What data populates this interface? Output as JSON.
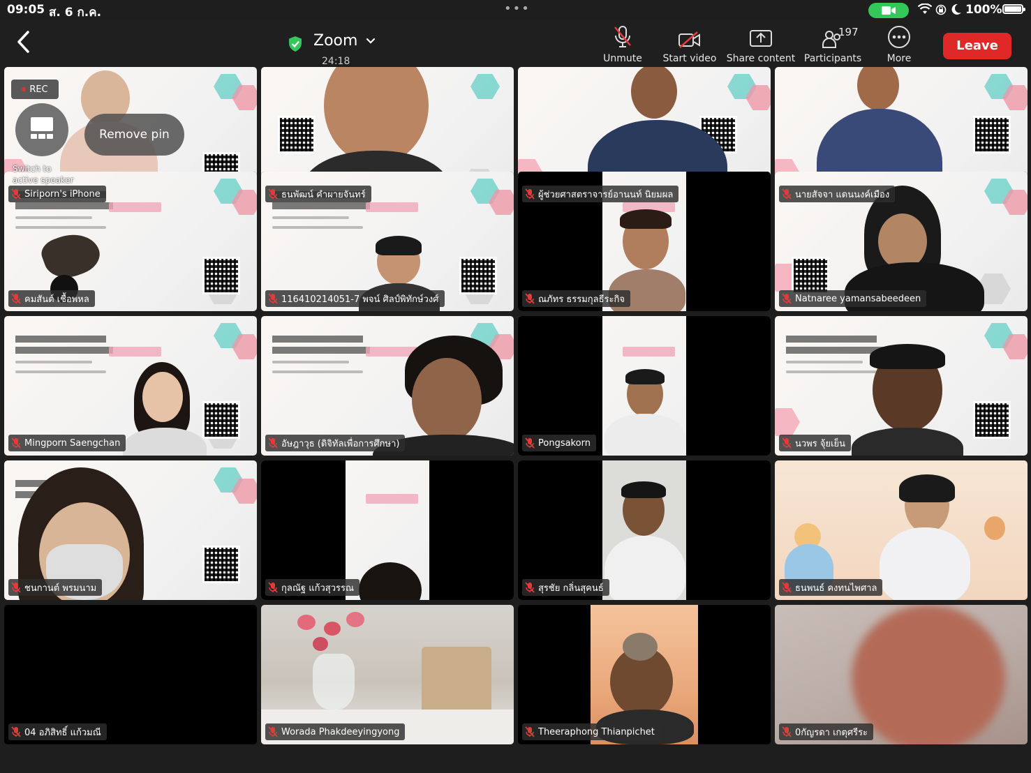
{
  "status_bar": {
    "time": "09:05",
    "date": "ส. 6 ก.ค.",
    "more_dots": "•••",
    "battery_percent": "100%",
    "camera_indicator_color": "#34c759"
  },
  "toolbar": {
    "app_title": "Zoom",
    "meeting_timer": "24:18",
    "unmute_label": "Unmute",
    "start_video_label": "Start video",
    "share_content_label": "Share content",
    "participants_label": "Participants",
    "participants_count": "197",
    "more_label": "More",
    "leave_label": "Leave",
    "leave_color": "#e02828",
    "secure_shield_color": "#34c759"
  },
  "overlays": {
    "rec_label": "REC",
    "switch_label": "Switch to active speaker",
    "remove_pin_label": "Remove pin"
  },
  "participants": [
    {
      "name": "Siriporn's iPhone",
      "muted": true
    },
    {
      "name": "ธนพัฒน์ คำผายจันทร์",
      "muted": true
    },
    {
      "name": "ผู้ช่วยศาสตราจารย์อานนท์ นิยมผล",
      "muted": true
    },
    {
      "name": "นายสัจจา แดนนงค์เมือง",
      "muted": true
    },
    {
      "name": "คมสันต์ เชื้อพหล",
      "muted": true
    },
    {
      "name": "116410214051-7 พจน์ ศิลป์พิทักษ์วงศ์",
      "muted": true
    },
    {
      "name": "ณภัทร ธรรมกุลธีระกิจ",
      "muted": true
    },
    {
      "name": "Natnaree yamansabeedeen",
      "muted": true
    },
    {
      "name": "Mingporn Saengchan",
      "muted": true
    },
    {
      "name": "อัษฎาวุธ (ดิจิทัลเพื่อการศึกษา)",
      "muted": true
    },
    {
      "name": "Pongsakorn",
      "muted": true
    },
    {
      "name": "นวพร จุ้ยเย็น",
      "muted": true
    },
    {
      "name": "ชนกานต์ พรมนาม",
      "muted": true
    },
    {
      "name": "กุลณัฐ แก้วสุวรรณ",
      "muted": true
    },
    {
      "name": "สุรชัย กลิ่นสุคนธ์",
      "muted": true
    },
    {
      "name": "ธนพนธ์ คงทนไพศาล",
      "muted": true
    },
    {
      "name": "04 อภิสิทธิ์ แก้วมณี",
      "muted": true
    },
    {
      "name": "Worada Phakdeeyingyong",
      "muted": true
    },
    {
      "name": "Theeraphong Thianpichet",
      "muted": true
    },
    {
      "name": "0กัญรดา เกตุศรีระ",
      "muted": true
    }
  ]
}
